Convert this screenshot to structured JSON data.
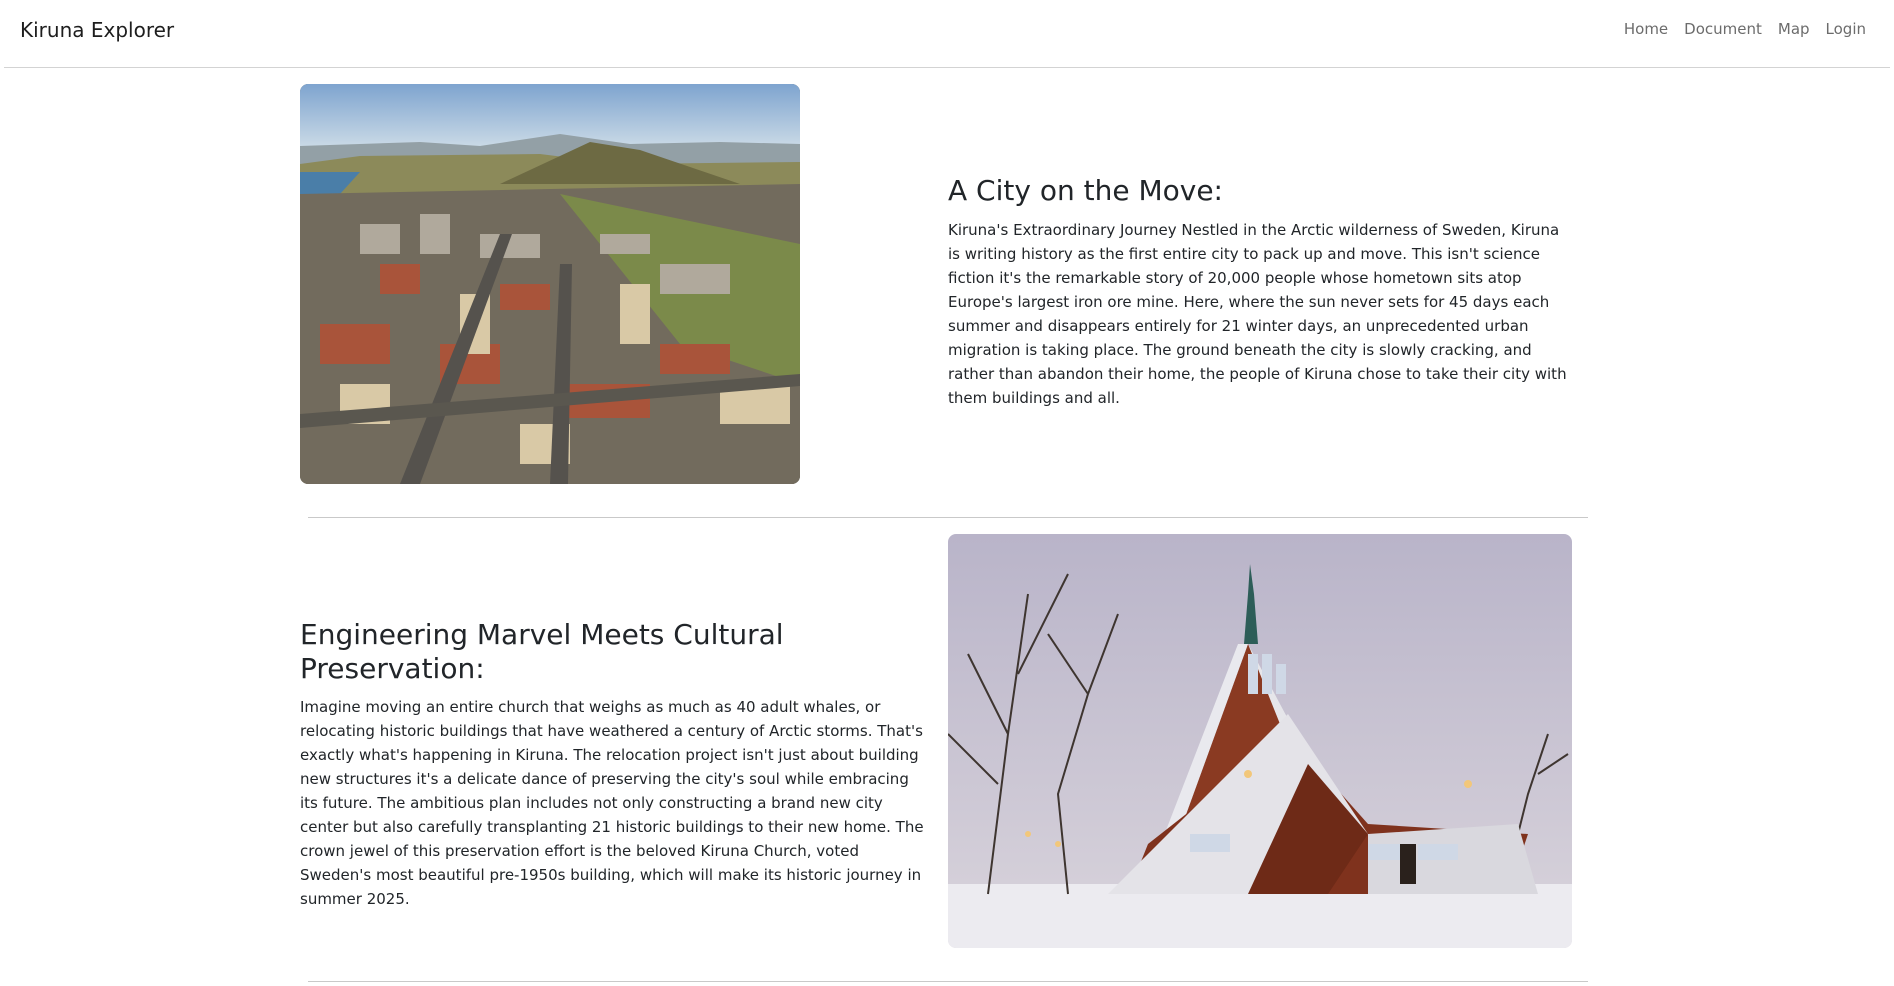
{
  "navbar": {
    "brand": "Kiruna Explorer",
    "links": [
      "Home",
      "Document",
      "Map",
      "Login"
    ]
  },
  "sections": [
    {
      "title": "A City on the Move:",
      "body": "Kiruna's Extraordinary Journey Nestled in the Arctic wilderness of Sweden, Kiruna is writing history as the first entire city to pack up and move. This isn't science fiction it's the remarkable story of 20,000 people whose hometown sits atop Europe's largest iron ore mine. Here, where the sun never sets for 45 days each summer and disappears entirely for 21 winter days, an unprecedented urban migration is taking place. The ground beneath the city is slowly cracking, and rather than abandon their home, the people of Kiruna chose to take their city with them buildings and all.",
      "image_icon": "aerial-city-photo"
    },
    {
      "title": "Engineering Marvel Meets Cultural Preservation:",
      "body": "Imagine moving an entire church that weighs as much as 40 adult whales, or relocating historic buildings that have weathered a century of Arctic storms. That's exactly what's happening in Kiruna. The relocation project isn't just about building new structures it's a delicate dance of preserving the city's soul while embracing its future. The ambitious plan includes not only constructing a brand new city center but also carefully transplanting 21 historic buildings to their new home. The crown jewel of this preservation effort is the beloved Kiruna Church, voted Sweden's most beautiful pre-1950s building, which will make its historic journey in summer 2025.",
      "image_icon": "kiruna-church-photo"
    }
  ]
}
